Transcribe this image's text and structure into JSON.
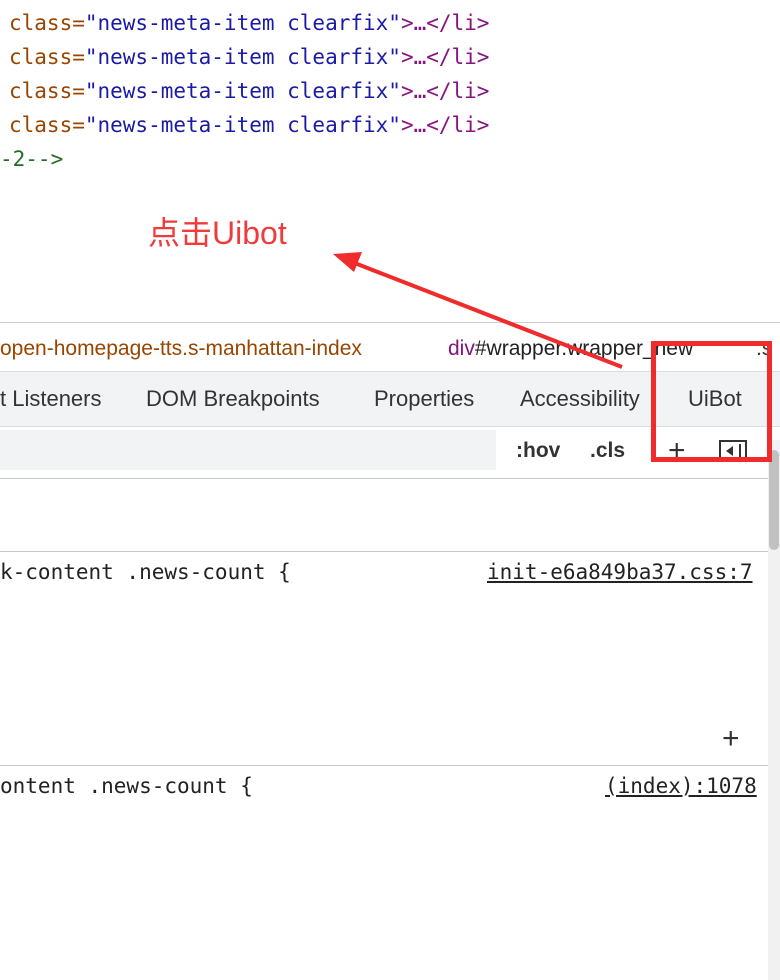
{
  "code_lines": [
    {
      "attr": "class=",
      "value": "\"news-meta-item clearfix\"",
      "after": ">…</li>"
    },
    {
      "attr": "class=",
      "value": "\"news-meta-item clearfix\"",
      "after": ">…</li>"
    },
    {
      "attr": "class=",
      "value": "\"news-meta-item clearfix\"",
      "after": ">…</li>"
    },
    {
      "attr": "class=",
      "value": "\"news-meta-item clearfix\"",
      "after": ">…</li>"
    }
  ],
  "comment_line": "-2-->",
  "annotation": "点击Uibot",
  "breadcrumb": {
    "item1": "open-homepage-tts.s-manhattan-index",
    "item2_tag": "div",
    "item2_rest": "#wrapper.wrapper_new",
    "item3": ".s"
  },
  "tabs": [
    "t Listeners",
    "DOM Breakpoints",
    "Properties",
    "Accessibility",
    "UiBot"
  ],
  "toolbar": {
    "hov": ":hov",
    "cls": ".cls",
    "plus": "+"
  },
  "rules": [
    {
      "selector": "k-content .news-count {",
      "source": "init-e6a849ba37.css:7"
    },
    {
      "selector": "ontent .news-count {",
      "source": "(index):1078"
    }
  ],
  "colors": {
    "annotation_red": "#ef3b3b",
    "highlight_red": "#ef2b2b"
  }
}
